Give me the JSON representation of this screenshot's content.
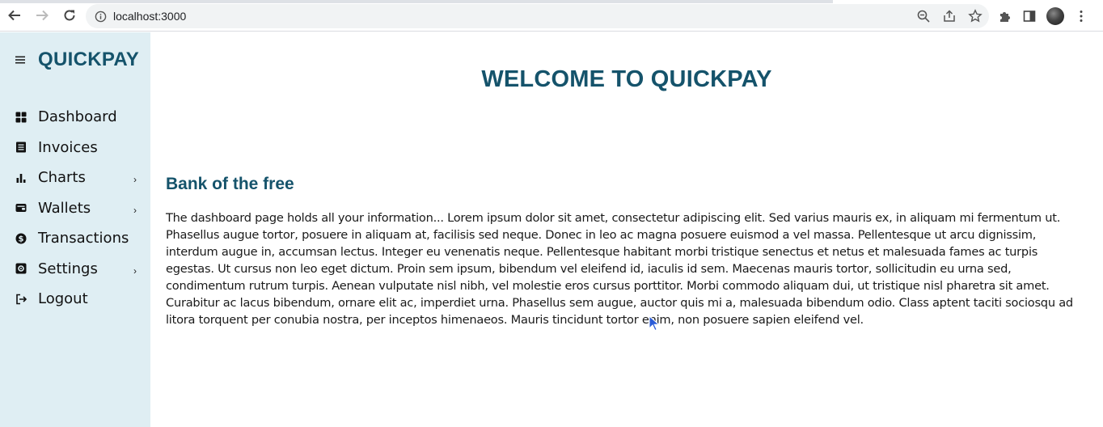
{
  "browser": {
    "url": "localhost:3000"
  },
  "sidebar": {
    "brand": "QUICKPAY",
    "items": [
      {
        "label": "Dashboard",
        "icon": "dashboard-icon",
        "has_submenu": false
      },
      {
        "label": "Invoices",
        "icon": "invoice-icon",
        "has_submenu": false
      },
      {
        "label": "Charts",
        "icon": "bar-chart-icon",
        "has_submenu": true
      },
      {
        "label": "Wallets",
        "icon": "wallet-icon",
        "has_submenu": true
      },
      {
        "label": "Transactions",
        "icon": "dollar-icon",
        "has_submenu": false
      },
      {
        "label": "Settings",
        "icon": "settings-icon",
        "has_submenu": true
      },
      {
        "label": "Logout",
        "icon": "logout-icon",
        "has_submenu": false
      }
    ],
    "chevron": "›"
  },
  "main": {
    "welcome": "WELCOME TO QUICKPAY",
    "section_title": "Bank of the free",
    "body": "The dashboard page holds all your information... Lorem ipsum dolor sit amet, consectetur adipiscing elit. Sed varius mauris ex, in aliquam mi fermentum ut. Phasellus augue tortor, posuere in aliquam at, facilisis sed neque. Donec in leo ac magna posuere euismod a vel massa. Pellentesque ut arcu dignissim, interdum augue in, accumsan lectus. Integer eu venenatis neque. Pellentesque habitant morbi tristique senectus et netus et malesuada fames ac turpis egestas. Ut cursus non leo eget dictum. Proin sem ipsum, bibendum vel eleifend id, iaculis id sem. Maecenas mauris tortor, sollicitudin eu urna sed, condimentum rutrum turpis. Aenean vulputate nisl nibh, vel molestie eros cursus porttitor. Morbi commodo aliquam dui, ut tristique nisl pharetra sit amet. Curabitur ac lacus bibendum, ornare elit ac, imperdiet urna. Phasellus sem augue, auctor quis mi a, malesuada bibendum odio. Class aptent taciti sociosqu ad litora torquent per conubia nostra, per inceptos himenaeos. Mauris tincidunt tortor enim, non posuere sapien eleifend vel."
  },
  "colors": {
    "brand": "#15536b",
    "sidebar_bg": "#dfeef3"
  }
}
